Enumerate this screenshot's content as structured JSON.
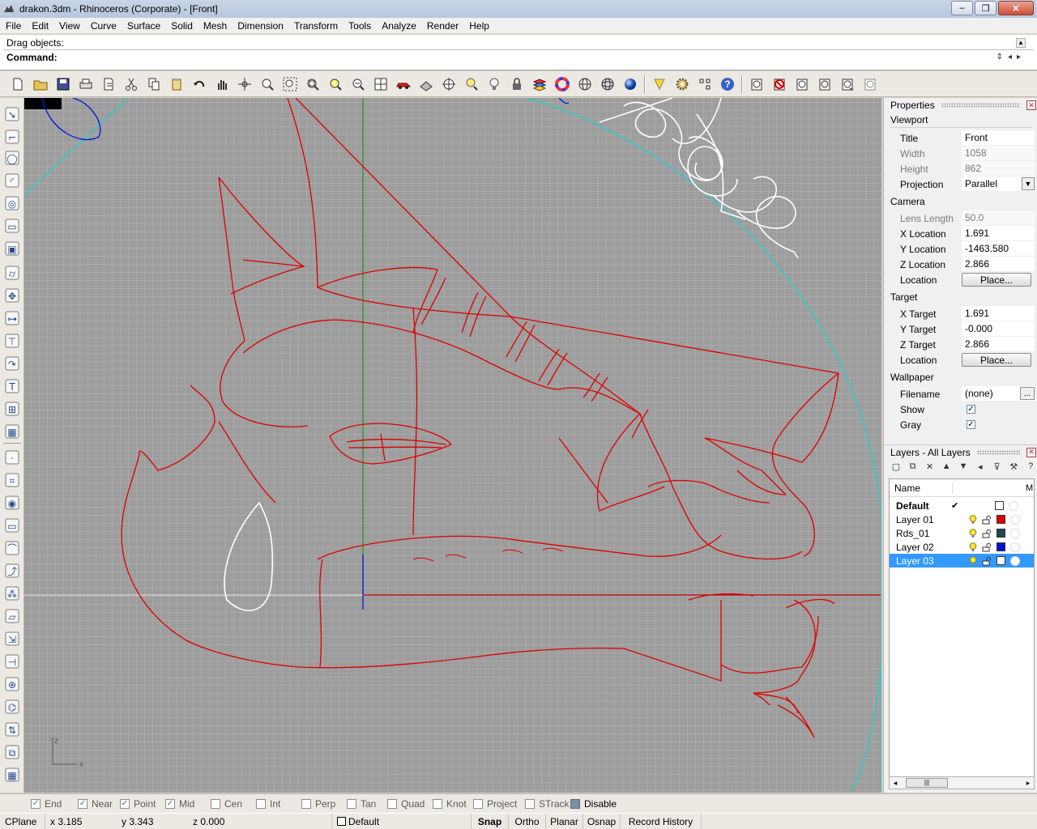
{
  "window": {
    "title": "drakon.3dm - Rhinoceros (Corporate) - [Front]"
  },
  "menu": [
    "File",
    "Edit",
    "View",
    "Curve",
    "Surface",
    "Solid",
    "Mesh",
    "Dimension",
    "Transform",
    "Tools",
    "Analyze",
    "Render",
    "Help"
  ],
  "command": {
    "history": "Drag objects:",
    "prompt": "Command:"
  },
  "toolbar": {
    "buttons": [
      "new-icon",
      "open-icon",
      "save-icon",
      "print-icon",
      "import-icon",
      "cut-icon",
      "copy-icon",
      "paste-icon",
      "undo-icon",
      "pan-icon",
      "rotate-view-icon",
      "zoom-dynamic-icon",
      "zoom-window-icon",
      "zoom-extents-icon",
      "zoom-selected-icon",
      "undo-view-icon",
      "four-viewports-icon",
      "car-object-icon",
      "cplane-icon",
      "osnap-icon",
      "light-icon",
      "bulb-icon",
      "lock-icon",
      "layer-icon",
      "color-wheel-icon",
      "wireframe-sphere-icon",
      "mesh-sphere-icon",
      "render-sphere-icon",
      "light-cone-icon",
      "gear-icon",
      "grid-snap-icon",
      "help-icon",
      "face-icon-1",
      "face-icon-2",
      "face-icon-3",
      "face-icon-4",
      "face-icon-5",
      "face-icon-6"
    ]
  },
  "lefttoolbar": [
    "select-arrow-icon",
    "polyline-icon",
    "circle-icon",
    "arc-icon",
    "ellipse-icon",
    "rectangle-icon",
    "box-icon",
    "cylinder-icon",
    "puzzle-icon",
    "cable-icon",
    "tee-icon",
    "curve-icon",
    "text-icon",
    "group-icon",
    "solid-box-icon",
    "point-icon",
    "control-points-icon",
    "circle-center-icon",
    "rectangle-curve-icon",
    "fillet-icon",
    "extrude-icon",
    "sphere-cluster-icon",
    "plane-surface-icon",
    "transform-icon",
    "dimension-icon",
    "array-icon",
    "boolean-icon",
    "move-icon",
    "mirror-icon",
    "stats-icon"
  ],
  "viewport": {
    "name": "Front",
    "axis_labels": {
      "z": "z",
      "x": "x"
    }
  },
  "properties": {
    "title": "Properties",
    "section_viewport": "Viewport",
    "section_camera": "Camera",
    "section_target": "Target",
    "section_wallpaper": "Wallpaper",
    "viewport_rows": [
      {
        "key": "Title",
        "value": "Front",
        "dim": false
      },
      {
        "key": "Width",
        "value": "1058",
        "dim": true
      },
      {
        "key": "Height",
        "value": "862",
        "dim": true
      },
      {
        "key": "Projection",
        "value": "Parallel",
        "dim": false
      }
    ],
    "camera_rows": [
      {
        "key": "Lens Length",
        "value": "50.0",
        "dim": true
      },
      {
        "key": "X Location",
        "value": "1.691",
        "dim": false
      },
      {
        "key": "Y Location",
        "value": "-1463.580",
        "dim": false
      },
      {
        "key": "Z Location",
        "value": "2.866",
        "dim": false
      }
    ],
    "camera_location": {
      "key": "Location",
      "button": "Place..."
    },
    "target_rows": [
      {
        "key": "X Target",
        "value": "1.691"
      },
      {
        "key": "Y Target",
        "value": "-0.000"
      },
      {
        "key": "Z Target",
        "value": "2.866"
      }
    ],
    "target_location": {
      "key": "Location",
      "button": "Place..."
    },
    "wallpaper": {
      "filename_key": "Filename",
      "filename_value": "(none)",
      "browse": "...",
      "show_key": "Show",
      "gray_key": "Gray",
      "show_checked": true,
      "gray_checked": true
    }
  },
  "layers": {
    "title": "Layers - All Layers",
    "columns": {
      "name": "Name",
      "m": "M"
    },
    "rows": [
      {
        "name": "Default",
        "current": true,
        "color": "#ffffff",
        "bold": true
      },
      {
        "name": "Layer 01",
        "current": false,
        "color": "#e00000",
        "bold": false
      },
      {
        "name": "Rds_01",
        "current": false,
        "color": "#1f4a50",
        "bold": false
      },
      {
        "name": "Layer 02",
        "current": false,
        "color": "#0010d0",
        "bold": false
      },
      {
        "name": "Layer 03",
        "current": false,
        "color": "#ffffff",
        "bold": false,
        "selected": true
      }
    ],
    "current_mark": "✔"
  },
  "osnaps": [
    {
      "label": "End",
      "checked": true
    },
    {
      "label": "Near",
      "checked": true
    },
    {
      "label": "Point",
      "checked": true
    },
    {
      "label": "Mid",
      "checked": true
    },
    {
      "label": "Cen",
      "checked": false
    },
    {
      "label": "Int",
      "checked": false
    },
    {
      "label": "Perp",
      "checked": false
    },
    {
      "label": "Tan",
      "checked": false
    },
    {
      "label": "Quad",
      "checked": false
    },
    {
      "label": "Knot",
      "checked": false
    },
    {
      "label": "Project",
      "checked": false
    },
    {
      "label": "STrack",
      "checked": false
    },
    {
      "label": "Disable",
      "checked": false
    }
  ],
  "status": {
    "cplane": "CPlane",
    "x": "x 3.185",
    "y": "y 3.343",
    "z": "z 0.000",
    "layer": "Default",
    "snap": "Snap",
    "ortho": "Ortho",
    "planar": "Planar",
    "osnap": "Osnap",
    "record_history": "Record History"
  },
  "colors": {
    "curve_red": "#dd0000",
    "curve_white": "#ffffff",
    "curve_cyan": "#2fc8c8",
    "curve_blue": "#0018d8",
    "axis_green": "#2f8f2f",
    "axis_red": "#c00000"
  }
}
